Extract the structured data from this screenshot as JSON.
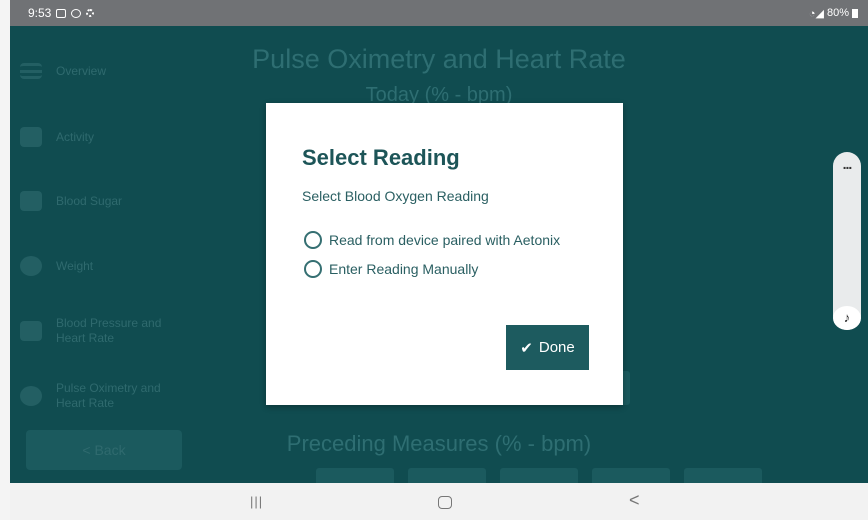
{
  "status_bar": {
    "time": "9:53",
    "battery": "80%"
  },
  "background": {
    "title": "Pulse Oximetry and Heart Rate",
    "subtitle": "Today (% - bpm)",
    "preceding": "Preceding Measures (% - bpm)",
    "sidebar": [
      {
        "label": "Overview"
      },
      {
        "label": "Activity"
      },
      {
        "label": "Blood Sugar"
      },
      {
        "label": "Weight"
      },
      {
        "label": "Blood Pressure and Heart Rate"
      },
      {
        "label": "Pulse Oximetry and Heart Rate"
      }
    ],
    "back_label": "< Back"
  },
  "dialog": {
    "title": "Select Reading",
    "subtitle": "Select Blood Oxygen Reading",
    "options": [
      {
        "label": "Read from device paired with Aetonix",
        "selected": false
      },
      {
        "label": "Enter Reading Manually",
        "selected": false
      }
    ],
    "done_label": "Done"
  },
  "side_handle": {
    "more": "...",
    "note": "♪"
  },
  "nav_bar": {
    "recents": "|||",
    "back": "<"
  },
  "colors": {
    "teal_dark": "#104c50",
    "button": "#1d5b5f",
    "title_text": "#1d5558"
  }
}
